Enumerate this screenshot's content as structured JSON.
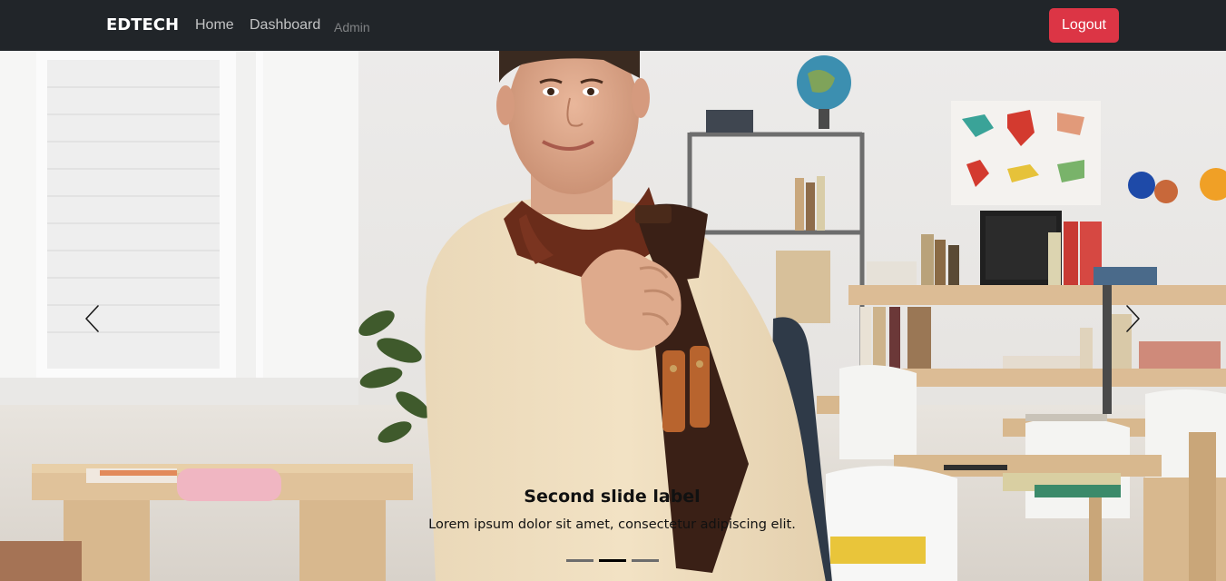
{
  "navbar": {
    "brand": "EDTECH",
    "links": [
      {
        "label": "Home"
      },
      {
        "label": "Dashboard"
      },
      {
        "label": "Admin"
      }
    ],
    "logout_label": "Logout"
  },
  "carousel": {
    "active_index": 1,
    "slide_count": 3,
    "caption_title": "Second slide label",
    "caption_text": "Lorem ipsum dolor sit amet, consectetur adipiscing elit.",
    "prev_icon": "chevron-left-icon",
    "next_icon": "chevron-right-icon"
  },
  "colors": {
    "navbar_bg": "#212529",
    "logout_bg": "#dc3545",
    "indicator_active": "#000000",
    "indicator_inactive": "#6c6c6c"
  }
}
